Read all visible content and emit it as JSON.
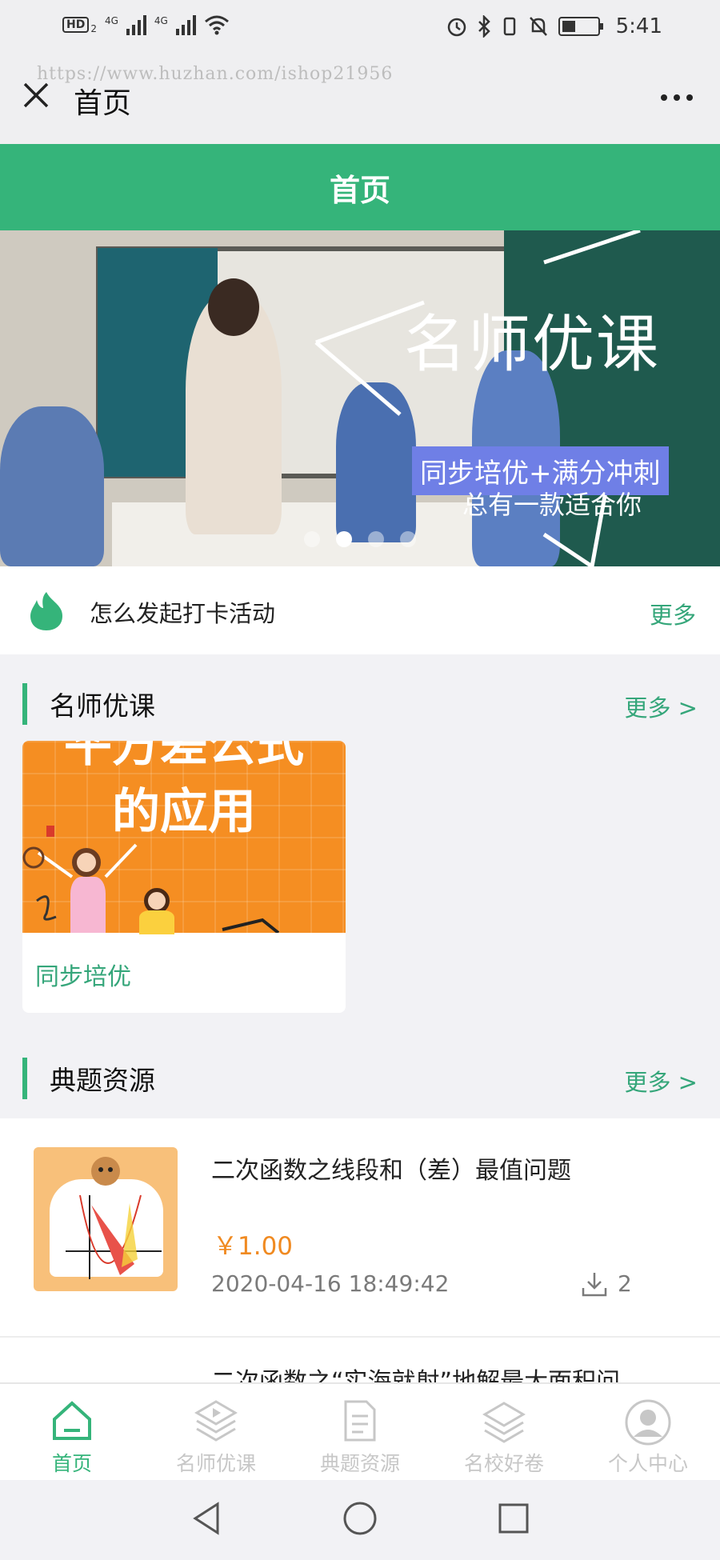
{
  "status_bar": {
    "network_badge": "HD",
    "network_sub": "2",
    "sim1": "4G",
    "sim2": "4G",
    "time": "5:41"
  },
  "nav": {
    "watermark": "https://www.huzhan.com/ishop21956",
    "title": "首页"
  },
  "header": {
    "title": "首页"
  },
  "banner": {
    "title": "名师优课",
    "subtitle": "同步培优+满分冲刺",
    "tagline": "总有一款适合你",
    "slide_count": 4,
    "active_slide": 2
  },
  "notice": {
    "text": "怎么发起打卡活动",
    "more": "更多"
  },
  "sections": {
    "courses": {
      "title": "名师优课",
      "more": "更多 >"
    },
    "resources": {
      "title": "典题资源",
      "more": "更多 >"
    }
  },
  "course_card": {
    "image_text_top": "平方差公式",
    "image_text": "的应用",
    "label": "同步培优"
  },
  "resource_item": {
    "title": "二次函数之线段和（差）最值问题",
    "price": "￥1.00",
    "date": "2020-04-16 18:49:42",
    "downloads": "2"
  },
  "next_item": {
    "title": "二次函数之“实海就射”地解最大面积问"
  },
  "tabs": [
    {
      "label": "首页",
      "icon": "home-icon",
      "active": true
    },
    {
      "label": "名师优课",
      "icon": "play-layers-icon",
      "active": false
    },
    {
      "label": "典题资源",
      "icon": "document-icon",
      "active": false
    },
    {
      "label": "名校好卷",
      "icon": "layers-icon",
      "active": false
    },
    {
      "label": "个人中心",
      "icon": "user-icon",
      "active": false
    }
  ],
  "colors": {
    "accent": "#35b47a",
    "price": "#f08a21",
    "inactive": "#c7c7c7"
  }
}
